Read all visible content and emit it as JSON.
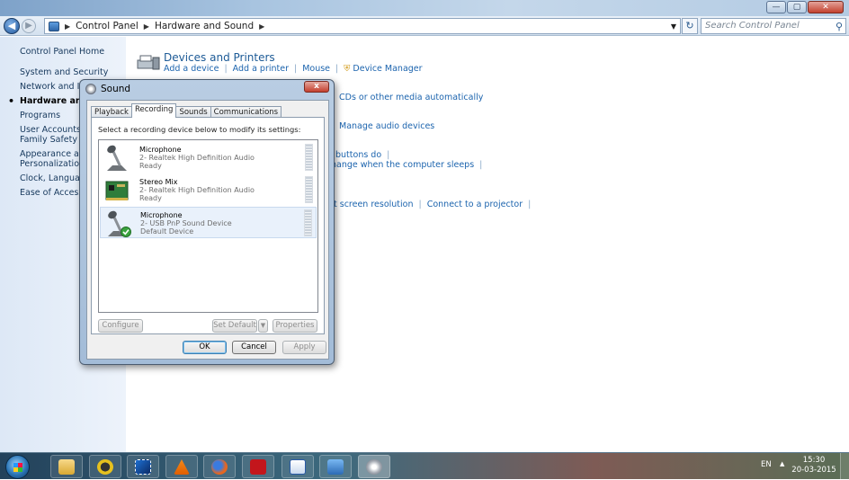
{
  "window": {
    "controls": {
      "minimize": "—",
      "maximize": "▢",
      "close": "✕"
    }
  },
  "address": {
    "breadcrumb": [
      "Control Panel",
      "Hardware and Sound"
    ],
    "search_placeholder": "Search Control Panel"
  },
  "sidebar": {
    "items": [
      {
        "label": "Control Panel Home"
      },
      {
        "label": "System and Security"
      },
      {
        "label": "Network and Internet"
      },
      {
        "label": "Hardware and Sound",
        "active": true
      },
      {
        "label": "Programs"
      },
      {
        "label": "User Accounts and Family Safety"
      },
      {
        "label": "Appearance and Personalization"
      },
      {
        "label": "Clock, Language, and Region"
      },
      {
        "label": "Ease of Access"
      }
    ]
  },
  "main": {
    "devices_printers": {
      "title": "Devices and Printers",
      "links": [
        "Add a device",
        "Add a printer",
        "Mouse",
        "Device Manager"
      ]
    },
    "partial_links": {
      "autoplay": "CDs or other media automatically",
      "sound": "Manage audio devices",
      "power_1": "buttons do",
      "power_2": "hange when the computer sleeps",
      "display_1": "t screen resolution",
      "display_2": "Connect to a projector"
    }
  },
  "dialog": {
    "title": "Sound",
    "close": "x",
    "tabs": [
      "Playback",
      "Recording",
      "Sounds",
      "Communications"
    ],
    "active_tab": "Recording",
    "instruction": "Select a recording device below to modify its settings:",
    "devices": [
      {
        "name": "Microphone",
        "line2": "2- Realtek High Definition Audio",
        "status": "Ready",
        "icon": "microphone-icon"
      },
      {
        "name": "Stereo Mix",
        "line2": "2- Realtek High Definition Audio",
        "status": "Ready",
        "icon": "sound-card-icon"
      },
      {
        "name": "Microphone",
        "line2": "2- USB PnP Sound Device",
        "status": "Default Device",
        "icon": "microphone-default-icon",
        "selected": true
      }
    ],
    "buttons": {
      "configure": "Configure",
      "set_default": "Set Default",
      "properties": "Properties",
      "ok": "OK",
      "cancel": "Cancel",
      "apply": "Apply"
    }
  },
  "taskbar": {
    "language": "EN",
    "time": "15:30",
    "date": "20-03-2015",
    "pinned_icons": [
      "explorer-icon",
      "camtasia-icon",
      "video-editor-icon",
      "vlc-icon",
      "firefox-icon",
      "acrobat-icon",
      "word-icon",
      "control-panel-icon",
      "sound-icon"
    ]
  }
}
